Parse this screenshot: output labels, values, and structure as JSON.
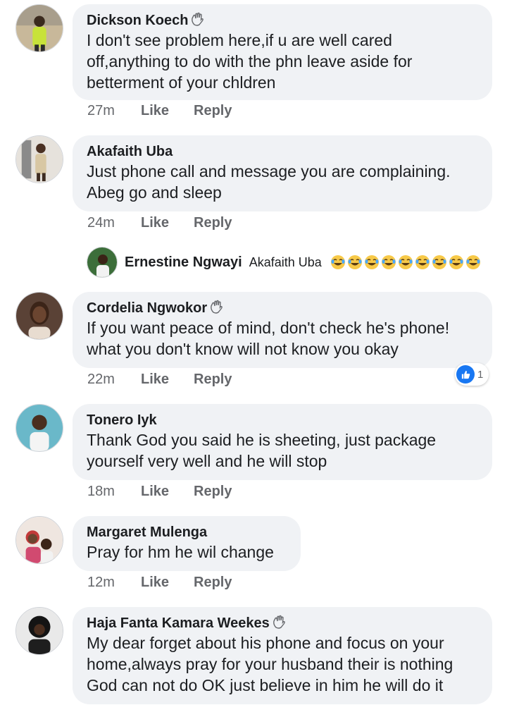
{
  "comments": [
    {
      "author": "Dickson Koech",
      "wave": true,
      "text": "I don't see problem here,if u are well cared off,anything to do with the phn leave aside for betterment of your chldren",
      "time": "27m",
      "like": "Like",
      "reply": "Reply"
    },
    {
      "author": "Akafaith Uba",
      "wave": false,
      "text": "Just phone call and message you are complaining. Abeg go and sleep",
      "time": "24m",
      "like": "Like",
      "reply": "Reply"
    },
    {
      "author": "Cordelia Ngwokor",
      "wave": true,
      "text": "If you want peace of mind, don't check he's phone! what you don't know will not know you okay",
      "time": "22m",
      "like": "Like",
      "reply": "Reply",
      "reaction_count": "1"
    },
    {
      "author": "Tonero Iyk",
      "wave": false,
      "text": "Thank God you said he is sheeting, just package yourself very well and he will stop",
      "time": "18m",
      "like": "Like",
      "reply": "Reply"
    },
    {
      "author": "Margaret Mulenga",
      "wave": false,
      "text": "Pray for hm he wil change",
      "time": "12m",
      "like": "Like",
      "reply": "Reply"
    },
    {
      "author": "Haja Fanta Kamara Weekes",
      "wave": true,
      "text": "My dear forget about his phone and focus on your home,always pray for your husband their is nothing God can not do OK just believe in him he will do it",
      "time": "",
      "like": "",
      "reply": ""
    }
  ],
  "reply_preview": {
    "author": "Ernestine Ngwayi",
    "mention": "Akafaith Uba",
    "emoji_icon": "laughing-emoji",
    "emoji_count": 9
  },
  "icons": {
    "wave": "waving-hand-icon",
    "like_reaction": "thumbs-up-icon"
  },
  "colors": {
    "bubble": "#f0f2f5",
    "meta_text": "#65676b",
    "like_blue": "#1877f2"
  }
}
